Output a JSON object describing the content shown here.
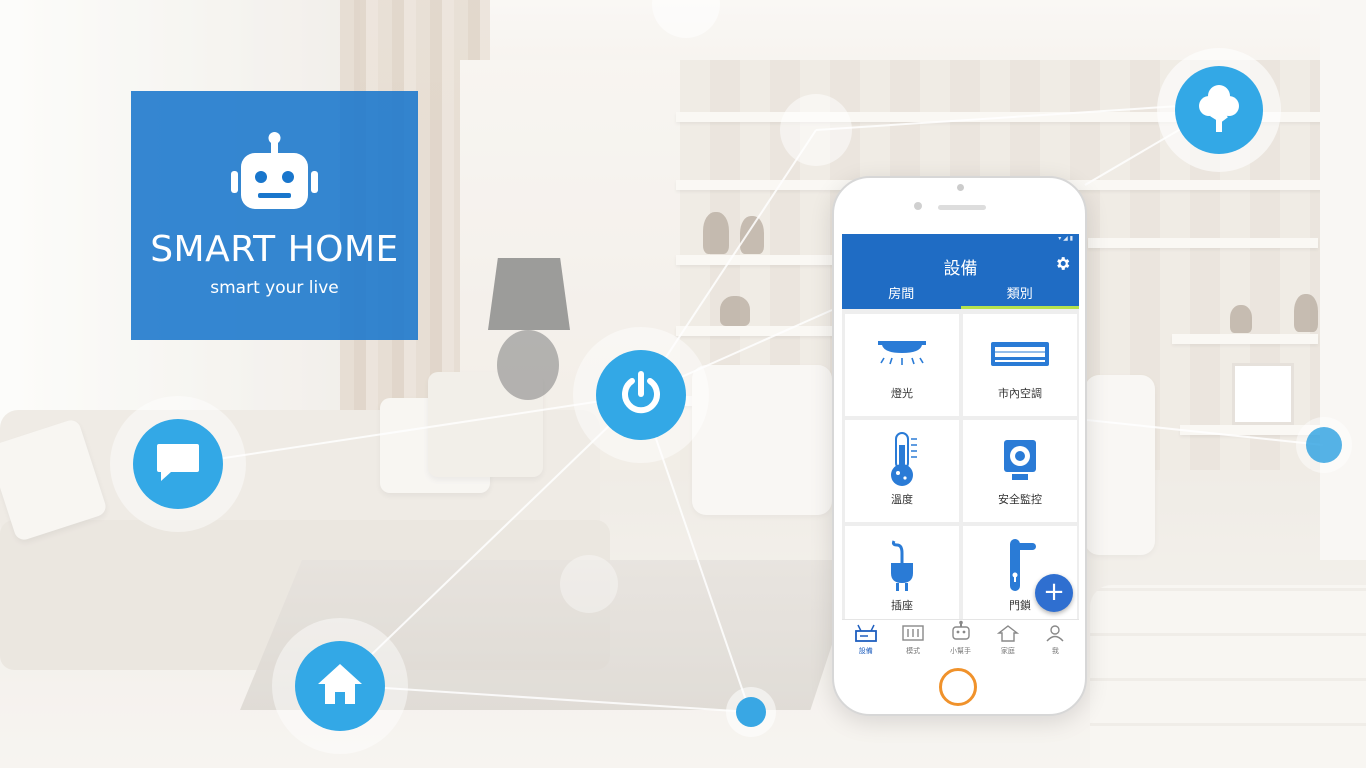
{
  "brand": {
    "title": "SMART HOME",
    "tagline": "smart your live",
    "icon": "robot-icon"
  },
  "colors": {
    "accent_blue": "#33a8e6",
    "brand_blue": "#1976cc",
    "app_bar": "#1f6cc4",
    "tab_indicator": "#b5e34d",
    "home_button": "#f0922b"
  },
  "nodes": [
    {
      "icon": "chat-bubble-icon"
    },
    {
      "icon": "power-icon"
    },
    {
      "icon": "house-icon"
    },
    {
      "icon": "tree-icon"
    }
  ],
  "app": {
    "title": "設備",
    "settings_icon": "gear-icon",
    "tabs": [
      {
        "label": "房間",
        "active": false
      },
      {
        "label": "類別",
        "active": true
      }
    ],
    "devices": [
      {
        "label": "燈光",
        "icon": "ceiling-light-icon"
      },
      {
        "label": "市內空調",
        "icon": "air-conditioner-icon"
      },
      {
        "label": "溫度",
        "icon": "thermometer-icon"
      },
      {
        "label": "安全監控",
        "icon": "camera-icon"
      },
      {
        "label": "插座",
        "icon": "plug-icon"
      },
      {
        "label": "門鎖",
        "icon": "door-handle-icon"
      }
    ],
    "fab_label": "+",
    "nav": [
      {
        "label": "設備",
        "icon": "router-icon",
        "active": true
      },
      {
        "label": "模式",
        "icon": "sliders-icon",
        "active": false
      },
      {
        "label": "小幫手",
        "icon": "robot-icon",
        "active": false
      },
      {
        "label": "家庭",
        "icon": "home-icon",
        "active": false
      },
      {
        "label": "我",
        "icon": "user-icon",
        "active": false
      }
    ]
  }
}
